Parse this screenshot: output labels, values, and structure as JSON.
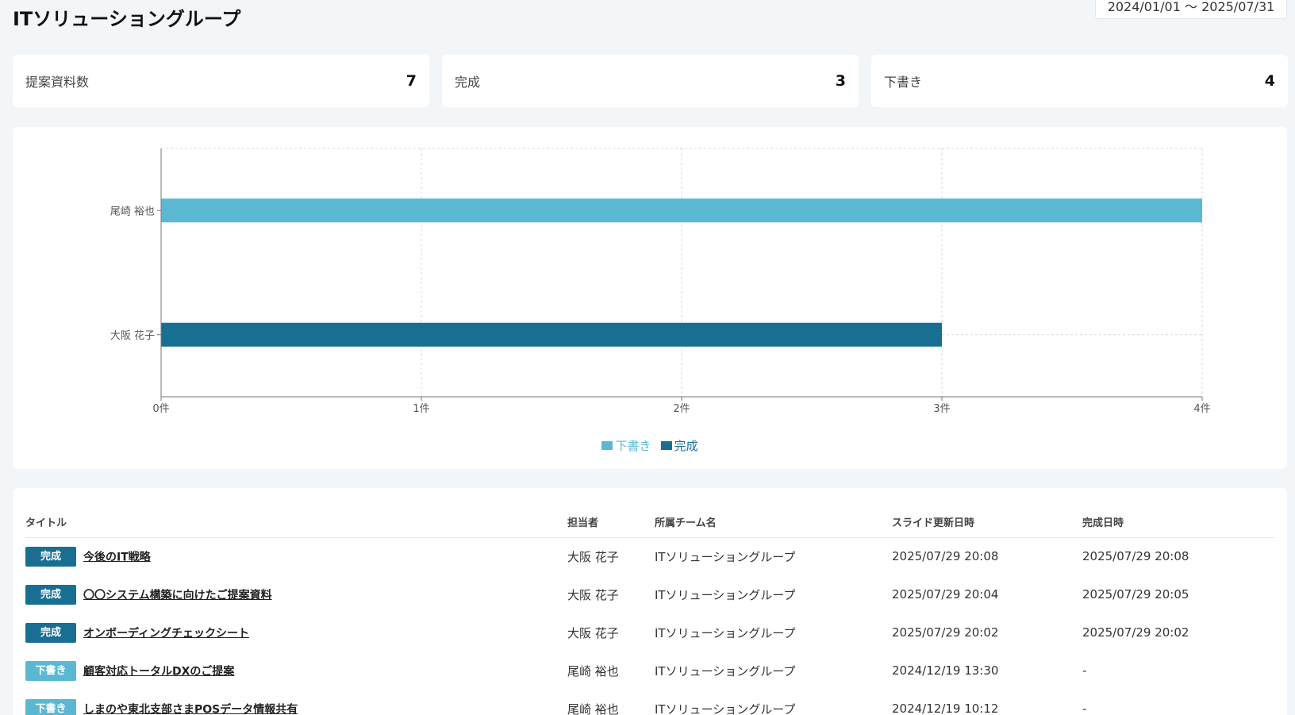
{
  "header": {
    "title": "ITソリューショングループ",
    "date_range": "2024/01/01 〜 2025/07/31"
  },
  "stats": [
    {
      "label": "提案資料数",
      "value": "7"
    },
    {
      "label": "完成",
      "value": "3"
    },
    {
      "label": "下書き",
      "value": "4"
    }
  ],
  "colors": {
    "draft": "#5bb8d2",
    "complete": "#186f92"
  },
  "chart_data": {
    "type": "bar",
    "orientation": "horizontal",
    "categories": [
      "尾崎 裕也",
      "大阪 花子"
    ],
    "series": [
      {
        "name": "下書き",
        "values": [
          4,
          0
        ],
        "color": "#5bb8d2"
      },
      {
        "name": "完成",
        "values": [
          0,
          3
        ],
        "color": "#186f92"
      }
    ],
    "x_ticks": [
      "0件",
      "1件",
      "2件",
      "3件",
      "4件"
    ],
    "xlim": [
      0,
      4
    ],
    "grid": true,
    "legend_position": "bottom"
  },
  "table": {
    "headers": [
      "タイトル",
      "担当者",
      "所属チーム名",
      "スライド更新日時",
      "完成日時"
    ],
    "rows": [
      {
        "status": "完成",
        "title": "今後のIT戦略",
        "owner": "大阪 花子",
        "team": "ITソリューショングループ",
        "updated": "2025/07/29 20:08",
        "completed": "2025/07/29 20:08"
      },
      {
        "status": "完成",
        "title": "〇〇システム構築に向けたご提案資料",
        "owner": "大阪 花子",
        "team": "ITソリューショングループ",
        "updated": "2025/07/29 20:04",
        "completed": "2025/07/29 20:05"
      },
      {
        "status": "完成",
        "title": "オンボーディングチェックシート",
        "owner": "大阪 花子",
        "team": "ITソリューショングループ",
        "updated": "2025/07/29 20:02",
        "completed": "2025/07/29 20:02"
      },
      {
        "status": "下書き",
        "title": "顧客対応トータルDXのご提案",
        "owner": "尾崎 裕也",
        "team": "ITソリューショングループ",
        "updated": "2024/12/19 13:30",
        "completed": "-"
      },
      {
        "status": "下書き",
        "title": "しまのや東北支部さまPOSデータ情報共有",
        "owner": "尾崎 裕也",
        "team": "ITソリューショングループ",
        "updated": "2024/12/19 10:12",
        "completed": "-"
      }
    ]
  }
}
